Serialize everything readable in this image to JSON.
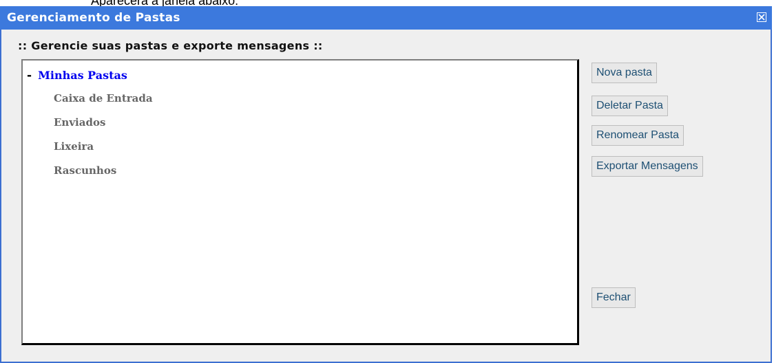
{
  "page": {
    "top_text": "Aparecerá a janela abaixo:"
  },
  "window": {
    "title": "Gerenciamento de Pastas",
    "subtitle": ":: Gerencie suas pastas e exporte mensagens ::",
    "close_icon": "close-box-icon"
  },
  "tree": {
    "toggle": "-",
    "root_label": "Minhas Pastas",
    "items": [
      {
        "label": "Caixa de Entrada"
      },
      {
        "label": "Enviados"
      },
      {
        "label": "Lixeira"
      },
      {
        "label": "Rascunhos"
      }
    ]
  },
  "buttons": {
    "new_folder": "Nova pasta",
    "delete_folder": "Deletar Pasta",
    "rename_folder": "Renomear Pasta",
    "export_messages": "Exportar Mensagens",
    "close": "Fechar"
  },
  "colors": {
    "titlebar": "#3c79dd",
    "root_link": "#0000ee",
    "button_text": "#1d4f73"
  }
}
